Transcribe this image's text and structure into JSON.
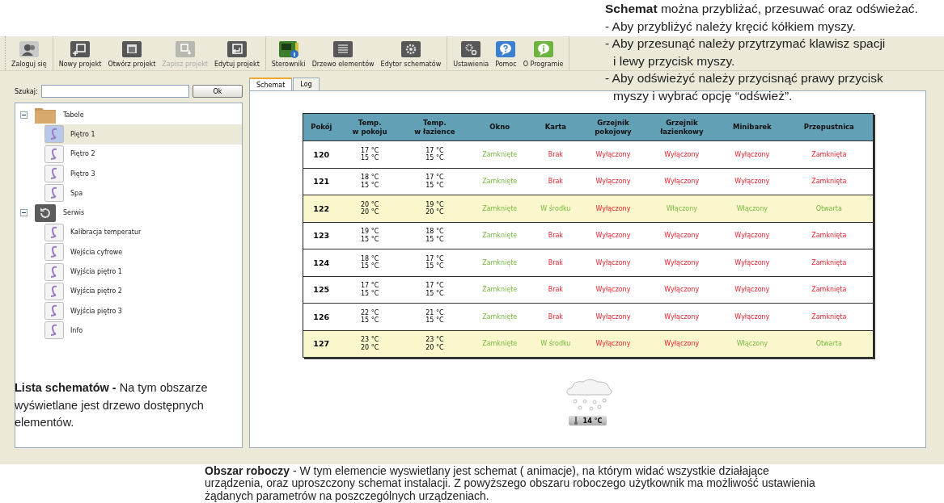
{
  "toolbar": {
    "groups": [
      [
        {
          "label": "Zaloguj się",
          "disabled": false
        }
      ],
      [
        {
          "label": "Nowy projekt",
          "disabled": false
        },
        {
          "label": "Otwórz projekt",
          "disabled": false
        },
        {
          "label": "Zapisz projekt",
          "disabled": true
        },
        {
          "label": "Edytuj projekt",
          "disabled": false
        }
      ],
      [
        {
          "label": "Sterowniki",
          "disabled": false
        },
        {
          "label": "Drzewo elementów",
          "disabled": false
        },
        {
          "label": "Edytor schematów",
          "disabled": false
        }
      ],
      [
        {
          "label": "Ustawienia",
          "disabled": false
        },
        {
          "label": "Pomoc",
          "disabled": false
        },
        {
          "label": "O Programie",
          "disabled": false
        }
      ]
    ]
  },
  "sidebar": {
    "search_label": "Szukaj:",
    "search_button": "Ok",
    "tree": [
      {
        "label": "Tabele",
        "expanded": true,
        "children": [
          {
            "label": "Piętro 1",
            "selected": true
          },
          {
            "label": "Piętro 2",
            "selected": false
          },
          {
            "label": "Piętro 3",
            "selected": false
          },
          {
            "label": "Spa",
            "selected": false
          }
        ]
      },
      {
        "label": "Serwis",
        "expanded": true,
        "children": [
          {
            "label": "Kalibracja temperatur",
            "selected": false
          },
          {
            "label": "Wejścia cyfrowe",
            "selected": false
          },
          {
            "label": "Wyjścia piętro 1",
            "selected": false
          },
          {
            "label": "Wyjścia piętro 2",
            "selected": false
          },
          {
            "label": "Wyjścia piętro 3",
            "selected": false
          },
          {
            "label": "Info",
            "selected": false
          }
        ]
      }
    ]
  },
  "tabs": [
    {
      "label": "Schemat",
      "selected": true
    },
    {
      "label": "Log",
      "selected": false
    }
  ],
  "table": {
    "columns": [
      "Pokój",
      "Temp.\nw pokoju",
      "Temp.\nw łazience",
      "Okno",
      "Karta",
      "Grzejnik\npokojowy",
      "Grzejnik\nłazienkowy",
      "Minibarek",
      "Przepustnica"
    ],
    "rows": [
      {
        "room": "120",
        "highlighted": false,
        "temp_room": [
          "17 °C",
          "15 °C"
        ],
        "temp_bath": [
          "17 °C",
          "15 °C"
        ],
        "status": [
          {
            "text": "Zamknięte",
            "alert": false
          },
          {
            "text": "Brak",
            "alert": true
          },
          {
            "text": "Wyłączony",
            "alert": true
          },
          {
            "text": "Wyłączony",
            "alert": true
          },
          {
            "text": "Wyłączony",
            "alert": true
          },
          {
            "text": "Zamknięta",
            "alert": true
          }
        ]
      },
      {
        "room": "121",
        "highlighted": false,
        "temp_room": [
          "18 °C",
          "15 °C"
        ],
        "temp_bath": [
          "17 °C",
          "15 °C"
        ],
        "status": [
          {
            "text": "Zamknięte",
            "alert": false
          },
          {
            "text": "Brak",
            "alert": true
          },
          {
            "text": "Wyłączony",
            "alert": true
          },
          {
            "text": "Wyłączony",
            "alert": true
          },
          {
            "text": "Wyłączony",
            "alert": true
          },
          {
            "text": "Zamknięta",
            "alert": true
          }
        ]
      },
      {
        "room": "122",
        "highlighted": true,
        "temp_room": [
          "20 °C",
          "20 °C"
        ],
        "temp_bath": [
          "19 °C",
          "20 °C"
        ],
        "status": [
          {
            "text": "Zamknięte",
            "alert": false
          },
          {
            "text": "W środku",
            "alert": false
          },
          {
            "text": "Wyłączony",
            "alert": true
          },
          {
            "text": "Włączony",
            "alert": false
          },
          {
            "text": "Włączony",
            "alert": false
          },
          {
            "text": "Otwarta",
            "alert": false
          }
        ]
      },
      {
        "room": "123",
        "highlighted": false,
        "temp_room": [
          "19 °C",
          "15 °C"
        ],
        "temp_bath": [
          "18 °C",
          "15 °C"
        ],
        "status": [
          {
            "text": "Zamknięte",
            "alert": false
          },
          {
            "text": "Brak",
            "alert": true
          },
          {
            "text": "Wyłączony",
            "alert": true
          },
          {
            "text": "Wyłączony",
            "alert": true
          },
          {
            "text": "Wyłączony",
            "alert": true
          },
          {
            "text": "Zamknięta",
            "alert": true
          }
        ]
      },
      {
        "room": "124",
        "highlighted": false,
        "temp_room": [
          "18 °C",
          "15 °C"
        ],
        "temp_bath": [
          "17 °C",
          "15 °C"
        ],
        "status": [
          {
            "text": "Zamknięte",
            "alert": false
          },
          {
            "text": "Brak",
            "alert": true
          },
          {
            "text": "Wyłączony",
            "alert": true
          },
          {
            "text": "Wyłączony",
            "alert": true
          },
          {
            "text": "Wyłączony",
            "alert": true
          },
          {
            "text": "Zamknięta",
            "alert": true
          }
        ]
      },
      {
        "room": "125",
        "highlighted": false,
        "temp_room": [
          "17 °C",
          "15 °C"
        ],
        "temp_bath": [
          "17 °C",
          "15 °C"
        ],
        "status": [
          {
            "text": "Zamknięte",
            "alert": false
          },
          {
            "text": "Brak",
            "alert": true
          },
          {
            "text": "Wyłączony",
            "alert": true
          },
          {
            "text": "Wyłączony",
            "alert": true
          },
          {
            "text": "Wyłączony",
            "alert": true
          },
          {
            "text": "Zamknięta",
            "alert": true
          }
        ]
      },
      {
        "room": "126",
        "highlighted": false,
        "temp_room": [
          "22 °C",
          "15 °C"
        ],
        "temp_bath": [
          "21 °C",
          "15 °C"
        ],
        "status": [
          {
            "text": "Zamknięte",
            "alert": false
          },
          {
            "text": "Brak",
            "alert": true
          },
          {
            "text": "Wyłączony",
            "alert": true
          },
          {
            "text": "Wyłączony",
            "alert": true
          },
          {
            "text": "Wyłączony",
            "alert": true
          },
          {
            "text": "Zamknięta",
            "alert": true
          }
        ]
      },
      {
        "room": "127",
        "highlighted": true,
        "temp_room": [
          "23 °C",
          "20 °C"
        ],
        "temp_bath": [
          "23 °C",
          "20 °C"
        ],
        "status": [
          {
            "text": "Zamknięte",
            "alert": false
          },
          {
            "text": "W środku",
            "alert": false
          },
          {
            "text": "Wyłączony",
            "alert": true
          },
          {
            "text": "Wyłączony",
            "alert": true
          },
          {
            "text": "Włączony",
            "alert": false
          },
          {
            "text": "Otwarta",
            "alert": false
          }
        ]
      }
    ]
  },
  "weather": {
    "temperature": "14 °C"
  },
  "annotations": {
    "schema": [
      [
        "**Schemat** można przybliżać, przesuwać oraz odświeżać."
      ],
      [
        "- Aby przybliżyć należy  kręcić  kółkiem myszy."
      ],
      [
        "- Aby przesunąć należy przytrzymać klawisz spacji",
        "i lewy przycisk myszy."
      ],
      [
        "- Aby odświeżyć należy przycisnąć prawy przycisk",
        "myszy i wybrać opcję “odśwież”."
      ]
    ],
    "list": [
      "**Lista schematów -** Na tym obszarze",
      "wyświetlane jest drzewo dostępnych",
      "elementów."
    ],
    "workspace": [
      "**Obszar roboczy** - W tym elemencie wyswietlany jest  schemat ( animacje), na którym widać  wszystkie  działające",
      "urządzenia, oraz uproszczony schemat instalacji.  Z powyższego obszaru roboczego użytkownik  ma możliwość ustawienia",
      "żądanych parametrów na poszczególnych urządzeniach."
    ]
  }
}
